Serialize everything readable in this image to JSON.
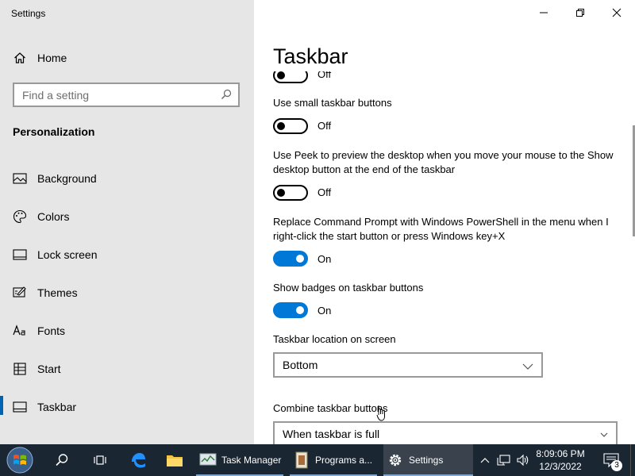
{
  "window": {
    "title": "Settings"
  },
  "sidebar": {
    "home_label": "Home",
    "search_placeholder": "Find a setting",
    "section_title": "Personalization",
    "items": [
      {
        "label": "Background",
        "icon": "picture-icon"
      },
      {
        "label": "Colors",
        "icon": "palette-icon"
      },
      {
        "label": "Lock screen",
        "icon": "lock-screen-icon"
      },
      {
        "label": "Themes",
        "icon": "themes-icon"
      },
      {
        "label": "Fonts",
        "icon": "fonts-icon"
      },
      {
        "label": "Start",
        "icon": "start-icon"
      },
      {
        "label": "Taskbar",
        "icon": "taskbar-icon",
        "active": true
      }
    ]
  },
  "main": {
    "title": "Taskbar",
    "settings": [
      {
        "label": "",
        "state": "Off"
      },
      {
        "label": "Use small taskbar buttons",
        "state": "Off"
      },
      {
        "label": "Use Peek to preview the desktop when you move your mouse to the Show desktop button at the end of the taskbar",
        "state": "Off"
      },
      {
        "label": "Replace Command Prompt with Windows PowerShell in the menu when I right-click the start button or press Windows key+X",
        "state": "On"
      },
      {
        "label": "Show badges on taskbar buttons",
        "state": "On"
      }
    ],
    "location_label": "Taskbar location on screen",
    "location_value": "Bottom",
    "combine_label": "Combine taskbar buttons",
    "combine_value": "When taskbar is full"
  },
  "taskbar": {
    "apps": [
      {
        "label": "Task Manager",
        "icon": "task-manager-icon"
      },
      {
        "label": "Programs a...",
        "icon": "programs-icon"
      },
      {
        "label": "Settings",
        "icon": "gear-icon",
        "active": true
      }
    ],
    "time": "8:09:06 PM",
    "date": "12/3/2022",
    "notification_count": "3"
  },
  "colors": {
    "accent": "#0078d7",
    "sidebar_bg": "#e6e6e6",
    "taskbar_bg": "#1b2633"
  }
}
